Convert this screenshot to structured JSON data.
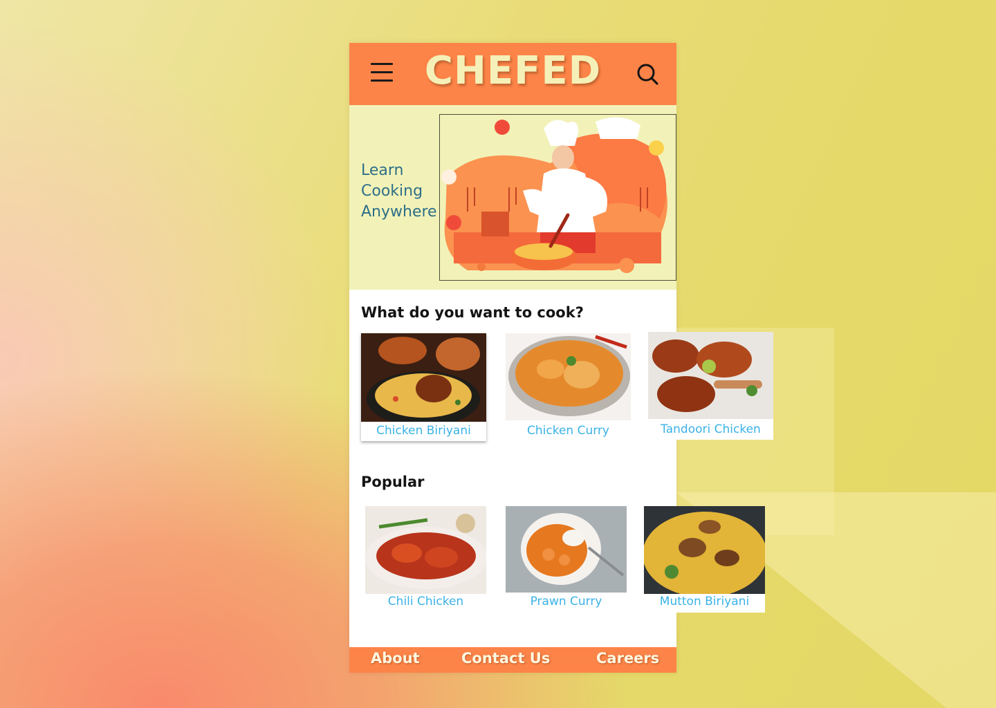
{
  "app": {
    "brand": "CHEFED",
    "colors": {
      "header": "#fd8448",
      "hero_bg": "#f2f2b8",
      "link_blue": "#3ab2e6",
      "tagline": "#2d6e88"
    }
  },
  "header": {
    "menu_icon": "hamburger-menu-icon",
    "search_icon": "search-icon"
  },
  "hero": {
    "tagline_lines": [
      "Learn",
      "Cooking",
      "Anywhere"
    ],
    "illustration": "chef-cooking-illustration"
  },
  "categories": {
    "title": "What do you want to cook?",
    "items": [
      {
        "label": "Chicken Biriyani",
        "image": "chicken-biriyani-photo"
      },
      {
        "label": "Chicken Curry",
        "image": "chicken-curry-photo"
      },
      {
        "label": "Tandoori Chicken",
        "image": "tandoori-chicken-photo"
      }
    ]
  },
  "popular": {
    "title": "Popular",
    "items": [
      {
        "label": "Chili Chicken",
        "image": "chili-chicken-photo"
      },
      {
        "label": "Prawn Curry",
        "image": "prawn-curry-photo"
      },
      {
        "label": "Mutton Biriyani",
        "image": "mutton-biriyani-photo"
      }
    ]
  },
  "footer": {
    "links": [
      "About",
      "Contact Us",
      "Careers"
    ]
  }
}
